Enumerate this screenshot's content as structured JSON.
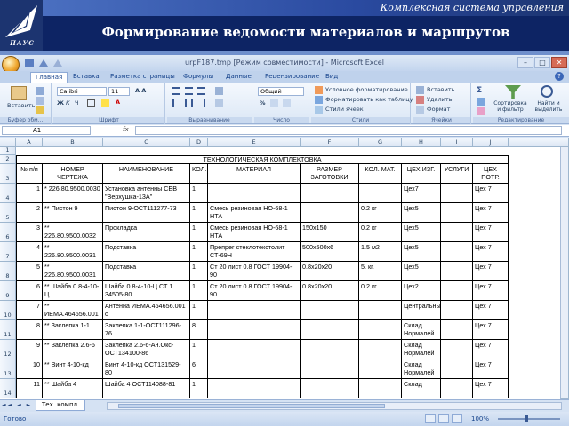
{
  "slide": {
    "org_name": "Комплексная система управления",
    "title": "Формирование ведомости материалов и маршрутов",
    "logo_text": "ПАУС"
  },
  "excel": {
    "window_title": "urpF187.tmp [Режим совместимости] - Microsoft Excel",
    "tabs": [
      "Главная",
      "Вставка",
      "Разметка страницы",
      "Формулы",
      "Данные",
      "Рецензирование",
      "Вид"
    ],
    "active_tab": "Главная",
    "ribbon": {
      "paste_label": "Вставить",
      "clipboard_group": "Буфер обм...",
      "font_name": "Calibri",
      "font_size": "11",
      "font_group": "Шрифт",
      "align_group": "Выравнивание",
      "number_format": "Общий",
      "number_group": "Число",
      "cond_format": "Условное форматирование",
      "table_format": "Форматировать как таблицу",
      "cell_styles": "Стили ячеек",
      "styles_group": "Стили",
      "insert_label": "Вставить",
      "delete_label": "Удалить",
      "format_label": "Формат",
      "cells_group": "Ячейки",
      "sort_label": "Сортировка и фильтр",
      "find_label": "Найти и выделить",
      "edit_group": "Редактирование",
      "bold_label": "Ж",
      "italic_label": "К",
      "underline_label": "Ч",
      "font_color_label": "А",
      "percent_label": "%",
      "sigma_label": "Σ"
    },
    "name_box": "A1",
    "fx_label": "fx",
    "columns": [
      "A",
      "B",
      "C",
      "D",
      "E",
      "F",
      "G",
      "H",
      "I",
      "J"
    ],
    "sheet_tab": "Тех. компл.",
    "status": "Готово",
    "zoom": "100%",
    "sheet_nav": "◄◄ ◄ ► ►►"
  },
  "table": {
    "title": "ТЕХНОЛОГИЧЕСКАЯ КОМПЛЕКТОВКА",
    "headers": [
      "№ п/п",
      "НОМЕР ЧЕРТЕЖА",
      "НАИМЕНОВАНИЕ",
      "КОЛ.",
      "МАТЕРИАЛ",
      "РАЗМЕР ЗАГОТОВКИ",
      "КОЛ. МАТ.",
      "ЦЕХ ИЗГ.",
      "УСЛУГИ",
      "ЦЕХ ПОТР."
    ],
    "rows": [
      {
        "rownum": "4",
        "n": "1",
        "drawing": "* 226.80.9500.0030",
        "name": "Установка антенны СЕВ \"Верхушка-13А\"",
        "qty": "1",
        "material": "",
        "size": "",
        "mat_qty": "",
        "shop": "Цех7",
        "services": "",
        "dest": "Цех 7"
      },
      {
        "rownum": "5",
        "n": "2",
        "drawing": "** Пистон 9",
        "name": "Пистон 9-ОСТ111277-73",
        "qty": "1",
        "material": "Смесь резиновая НО-68-1 НТА",
        "size": "",
        "mat_qty": "0.2 кг",
        "shop": "Цех5",
        "services": "",
        "dest": "Цех 7"
      },
      {
        "rownum": "6",
        "n": "3",
        "drawing": "** 226.80.9500.0032",
        "name": "Прокладка",
        "qty": "1",
        "material": "Смесь резиновая НО-68-1 НТА",
        "size": "150x150",
        "mat_qty": "0.2 кг",
        "shop": "Цех5",
        "services": "",
        "dest": "Цех 7"
      },
      {
        "rownum": "7",
        "n": "4",
        "drawing": "** 226.80.9500.0031",
        "name": "Подставка",
        "qty": "1",
        "material": "Препрег стеклотекстолит СТ-69Н",
        "size": "500x500x6",
        "mat_qty": "1.5 м2",
        "shop": "Цех5",
        "services": "",
        "dest": "Цех 7"
      },
      {
        "rownum": "8",
        "n": "5",
        "drawing": "** 226.80.9500.0031",
        "name": "Подставка",
        "qty": "1",
        "material": "Ст 20 лист 0.8 ГОСТ 19904-90",
        "size": "0.8x20x20",
        "mat_qty": "5. кг.",
        "shop": "Цех5",
        "services": "",
        "dest": "Цех 7"
      },
      {
        "rownum": "9",
        "n": "6",
        "drawing": "** Шайба 0.8-4-10-Ц",
        "name": "Шайба 0.8-4-10-Ц СТ 1 34505-80",
        "qty": "1",
        "material": "Ст 20 лист 0.8 ГОСТ 19904-90",
        "size": "0.8x20x20",
        "mat_qty": "0.2 кг",
        "shop": "Цех2",
        "services": "",
        "dest": "Цех 7"
      },
      {
        "rownum": "10",
        "n": "7",
        "drawing": "** ИЕМА.464656.001",
        "name": "Антенна ИЕМА.464656.001 с",
        "qty": "1",
        "material": "",
        "size": "",
        "mat_qty": "",
        "shop": "Центральный",
        "services": "",
        "dest": "Цех 7"
      },
      {
        "rownum": "11",
        "n": "8",
        "drawing": "** Заклепка 1-1",
        "name": "Заклепка 1-1-ОСТ111296-76",
        "qty": "8",
        "material": "",
        "size": "",
        "mat_qty": "",
        "shop": "Склад Нормалей",
        "services": "",
        "dest": "Цех 7"
      },
      {
        "rownum": "12",
        "n": "9",
        "drawing": "** Заклепка 2.6-6",
        "name": "Заклепка 2.6-6-Ан.Окс-ОСТ134100-86",
        "qty": "1",
        "material": "",
        "size": "",
        "mat_qty": "",
        "shop": "Склад Нормалей",
        "services": "",
        "dest": "Цех 7"
      },
      {
        "rownum": "13",
        "n": "10",
        "drawing": "** Винт 4-10-кд",
        "name": "Винт 4-10-кд ОСТ131529-80",
        "qty": "6",
        "material": "",
        "size": "",
        "mat_qty": "",
        "shop": "Склад Нормалей",
        "services": "",
        "dest": "Цех 7"
      },
      {
        "rownum": "14",
        "n": "11",
        "drawing": "** Шайба 4",
        "name": "Шайба 4 ОСТ114088-81",
        "qty": "1",
        "material": "",
        "size": "",
        "mat_qty": "",
        "shop": "Склад",
        "services": "",
        "dest": "Цех 7"
      }
    ]
  }
}
